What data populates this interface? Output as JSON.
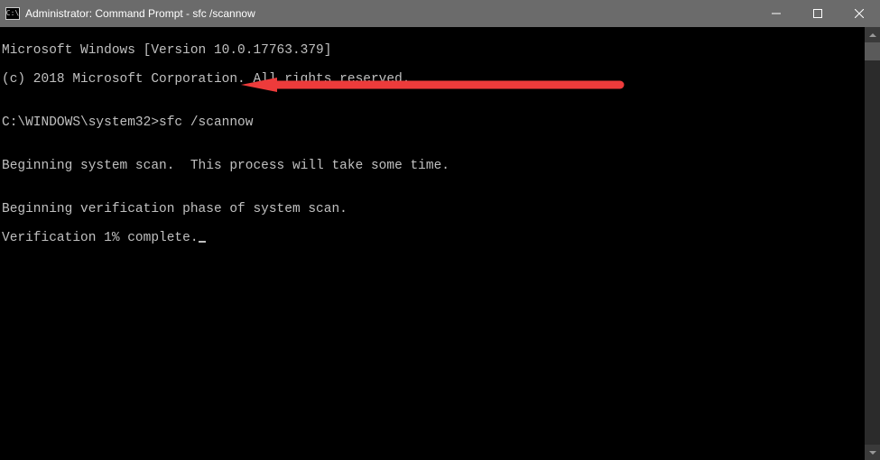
{
  "titlebar": {
    "icon_label": "C:\\",
    "title": "Administrator: Command Prompt - sfc  /scannow"
  },
  "terminal": {
    "line1": "Microsoft Windows [Version 10.0.17763.379]",
    "line2": "(c) 2018 Microsoft Corporation. All rights reserved.",
    "blank1": "",
    "prompt": "C:\\WINDOWS\\system32>",
    "command": "sfc /scannow",
    "blank2": "",
    "line3": "Beginning system scan.  This process will take some time.",
    "blank3": "",
    "line4": "Beginning verification phase of system scan.",
    "line5": "Verification 1% complete."
  },
  "annotation": {
    "color": "#ed3b3b"
  }
}
